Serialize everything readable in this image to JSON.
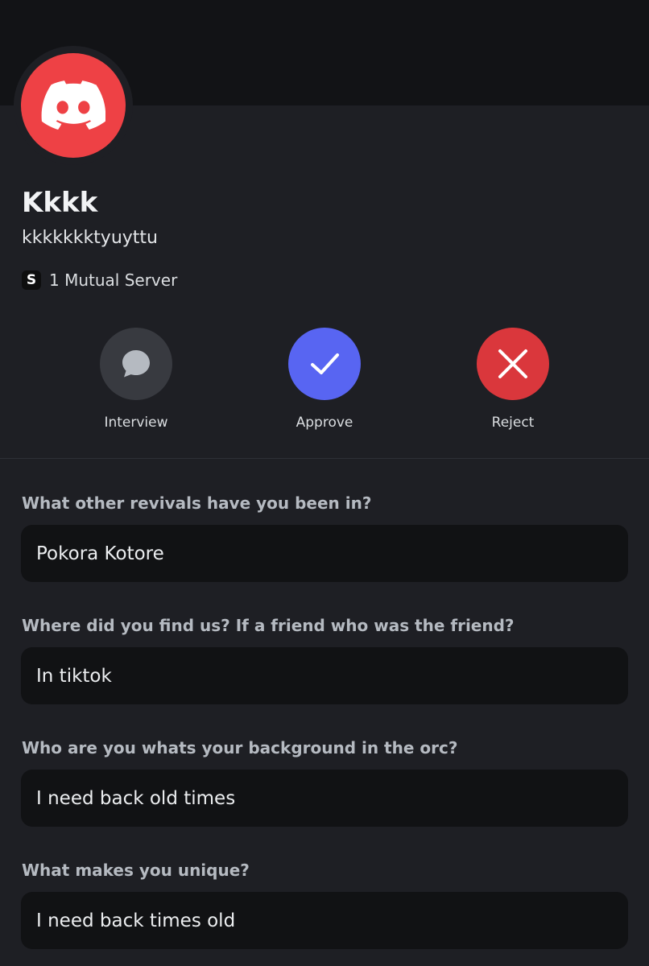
{
  "profile": {
    "display_name": "Kkkk",
    "username": "kkkkkkktyuyttu",
    "mutual_servers": "1 Mutual Server",
    "server_icon_letter": "S"
  },
  "actions": [
    {
      "label": "Interview",
      "icon": "chat-bubble-icon",
      "color": "#383a40"
    },
    {
      "label": "Approve",
      "icon": "checkmark-icon",
      "color": "#5865f2"
    },
    {
      "label": "Reject",
      "icon": "x-icon",
      "color": "#da373c"
    }
  ],
  "questions": [
    {
      "question": "What other revivals have you been in?",
      "answer": "Pokora Kotore"
    },
    {
      "question": "Where did you find us? If a friend who was the friend?",
      "answer": "In tiktok"
    },
    {
      "question": "Who are you whats your background in the orc?",
      "answer": "I need back old times"
    },
    {
      "question": "What makes you unique?",
      "answer": "I need back times old"
    }
  ],
  "colors": {
    "background": "#1e1f24",
    "banner": "#121316",
    "avatar": "#ee4145",
    "answer_box": "#111214"
  }
}
